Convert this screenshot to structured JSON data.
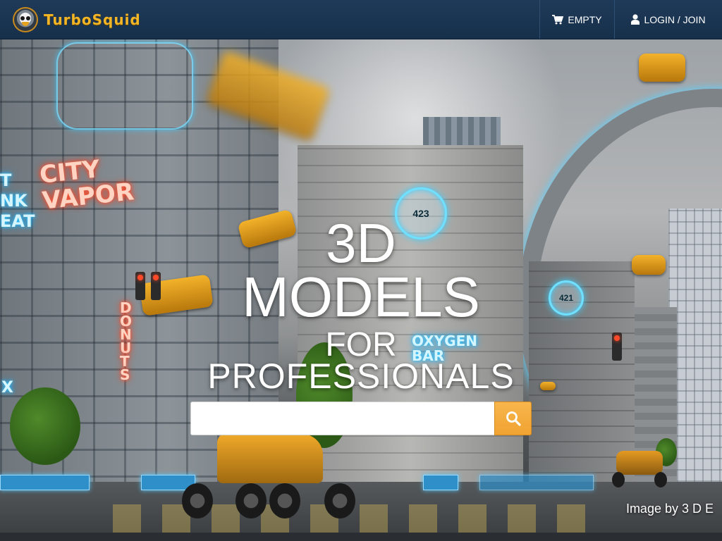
{
  "header": {
    "brand": "TurboSquid",
    "cart_label": "EMPTY",
    "login_label": "LOGIN / JOIN"
  },
  "hero": {
    "headline_line1": "3D",
    "headline_line2": "MODELS",
    "headline_line3": "FOR",
    "headline_line4": "PROFESSIONALS",
    "credit": "Image by 3 D E",
    "signs": {
      "city_vapor_line1": "CITY",
      "city_vapor_line2": "VAPOR",
      "donuts": "DONUTS",
      "oxygen_bar_line1": "OXYGEN",
      "oxygen_bar_line2": "BAR",
      "badge_423": "423",
      "badge_421": "421",
      "partial_left_line1": "T",
      "partial_left_line2": "NK",
      "partial_left_line3": "EAT",
      "partial_left_line4": "X"
    }
  },
  "search": {
    "value": "",
    "placeholder": ""
  },
  "icons": {
    "cart": "shopping-cart-icon",
    "user": "user-icon",
    "search": "magnifier-icon",
    "logo": "squid-mascot-icon"
  },
  "colors": {
    "header_bg": "#1b3551",
    "brand_gold": "#f2b526",
    "search_button": "#f4ab3a",
    "hologram_blue": "#6fe0ff"
  }
}
